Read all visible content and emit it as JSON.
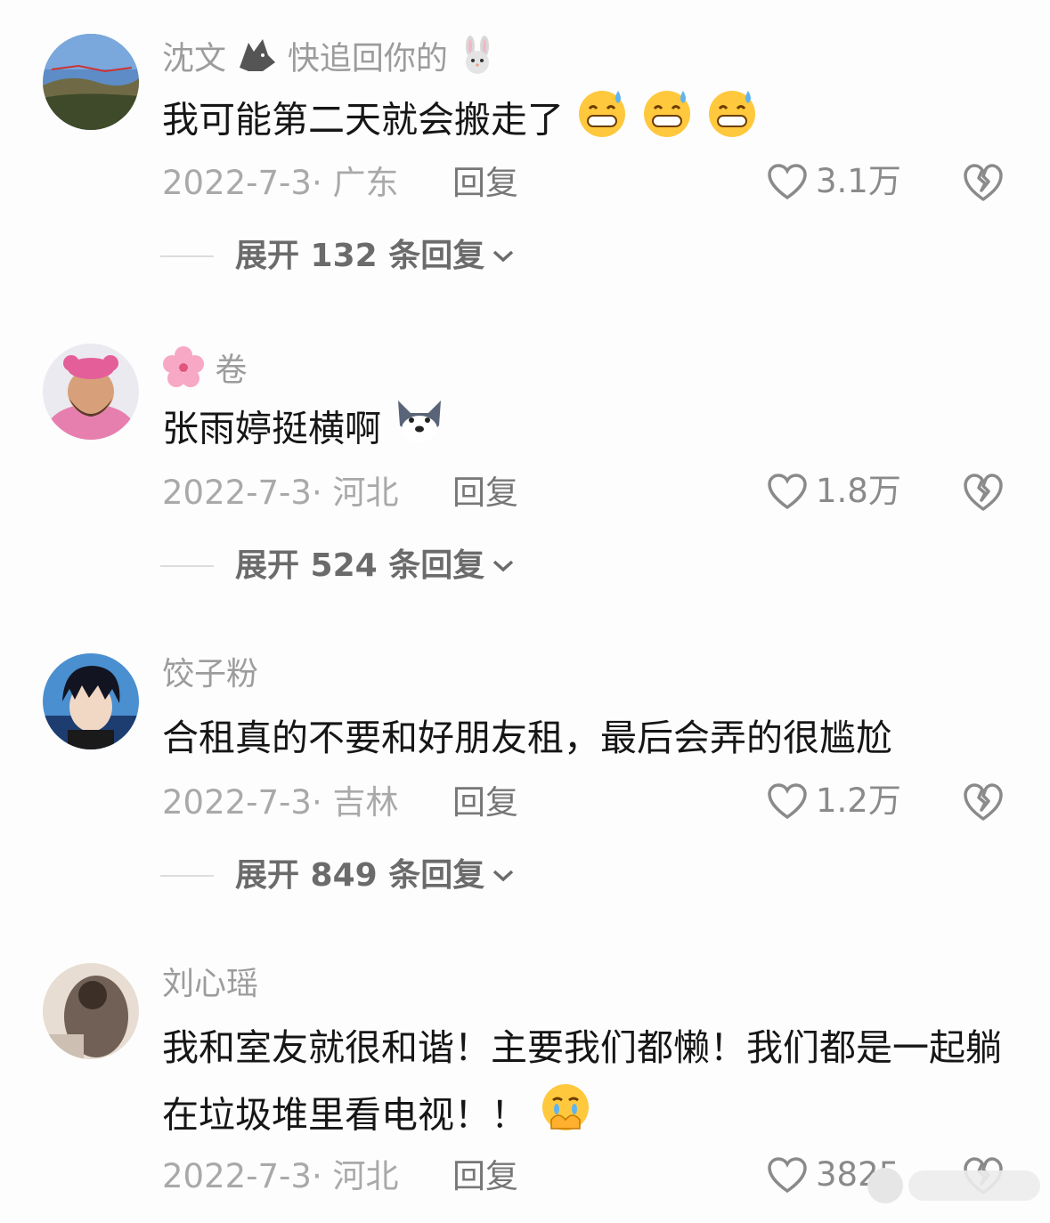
{
  "comments": [
    {
      "author": "沈文",
      "author_suffix": "快追回你的",
      "author_icons": [
        "wolf-emoji-icon",
        "rabbit-emoji-icon"
      ],
      "text": "我可能第二天就会搬走了",
      "text_emojis": [
        "grinning-sweat-emoji-icon",
        "grinning-sweat-emoji-icon",
        "grinning-sweat-emoji-icon"
      ],
      "date_location": "2022-7-3· 广东",
      "reply_label": "回复",
      "likes": "3.1万",
      "expand": "展开 132 条回复"
    },
    {
      "author": "卷",
      "author_icons": [
        "cherry-blossom-emoji-icon"
      ],
      "text": "张雨婷挺横啊",
      "text_emojis": [
        "husky-emoji-icon"
      ],
      "date_location": "2022-7-3· 河北",
      "reply_label": "回复",
      "likes": "1.8万",
      "expand": "展开 524 条回复"
    },
    {
      "author": "饺子粉",
      "text": "合租真的不要和好朋友租，最后会弄的很尴尬",
      "date_location": "2022-7-3· 吉林",
      "reply_label": "回复",
      "likes": "1.2万",
      "expand": "展开 849 条回复"
    },
    {
      "author": "刘心瑶",
      "text": "我和室友就很和谐！主要我们都懒！我们都是一起躺在垃圾堆里看电视！！",
      "text_emojis": [
        "crying-hands-emoji-icon"
      ],
      "date_location": "2022-7-3· 河北",
      "reply_label": "回复",
      "likes": "3825"
    }
  ],
  "colors": {
    "background": "#fdfdfd",
    "author": "#9c9c9c",
    "body_text": "#161616",
    "meta": "#a9a9a9",
    "expand": "#6b6b6b",
    "emoji_yellow": "#ffc83d"
  }
}
